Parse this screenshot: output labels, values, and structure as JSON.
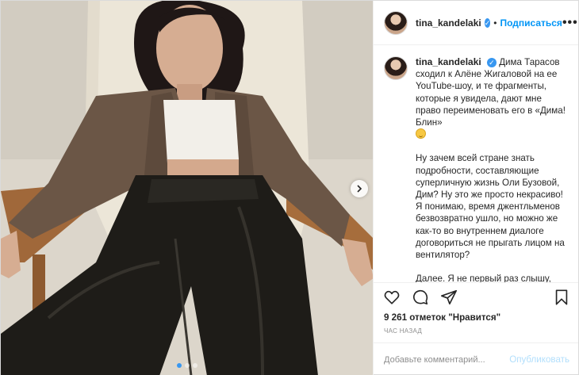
{
  "post": {
    "image_alt": "photo",
    "carousel": {
      "dots": 3,
      "active_index": 0
    }
  },
  "header": {
    "username": "tina_kandelaki",
    "separator": "•",
    "follow_label": "Подписаться",
    "more_label": "•••"
  },
  "caption": {
    "username": "tina_kandelaki",
    "paragraph_1": "Дима Тарасов сходил к Алёне Жигаловой на ее YouTube-шоу, и те фрагменты, которые я увидела, дают мне право переименовать его в «Дима! Блин»",
    "paragraph_2": "Ну зачем всей стране знать подробности, составляющие суперличную жизнь Оли Бузовой, Дим? Ну это же просто некрасиво! Я понимаю, время джентльменов безвозвратно ушло, но можно же как-то во внутреннем диалоге договориться не прыгать лицом на вентилятор?",
    "paragraph_3": "Далее. Я не первый раз слышу, что вот, Тина Канделаки поддержала Регину Тодоренко. Внимательно: я"
  },
  "likes": {
    "count_text": "9 261 отметок",
    "suffix": "\"Нравится\""
  },
  "timestamp": "час назад",
  "add_comment": {
    "placeholder": "Добавьте комментарий...",
    "publish_label": "Опубликовать"
  },
  "icons": [
    "heart-icon",
    "comment-icon",
    "share-icon",
    "bookmark-icon",
    "chevron-right-icon",
    "verified-icon",
    "smile-emoji-icon"
  ],
  "colors": {
    "link_blue": "#0095f6",
    "verified_blue": "#3897f0",
    "publish_disabled": "#b2dffc",
    "muted": "#8e8e8e"
  }
}
